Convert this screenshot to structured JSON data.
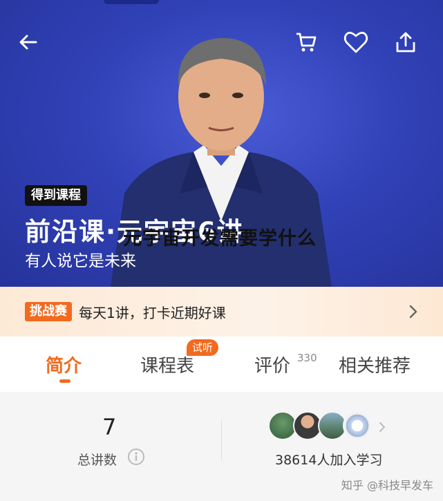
{
  "header": {
    "back_icon": "arrow-left-icon",
    "cart_icon": "cart-icon",
    "favorite_icon": "heart-icon",
    "share_icon": "share-icon"
  },
  "hero": {
    "tag": "得到课程",
    "title": "前沿课·元宇宙6讲",
    "subtitle": "有人说它是未来",
    "overlay_text": "元宇宙开发需要学什么"
  },
  "challenge": {
    "badge": "挑战赛",
    "text": "每天1讲，打卡近期好课",
    "arrow_icon": "chevron-right-icon"
  },
  "tabs": [
    {
      "label": "简介",
      "active": true
    },
    {
      "label": "课程表",
      "badge": "试听"
    },
    {
      "label": "评价",
      "count": "330"
    },
    {
      "label": "相关推荐"
    }
  ],
  "stats": {
    "lecture_count": "7",
    "lecture_label": "总讲数",
    "info_icon": "info-icon",
    "learners_text": "38614人加入学习"
  },
  "watermark": "知乎 @科技早发车",
  "colors": {
    "accent": "#f26a1e",
    "hero_blue": "#3142b8"
  }
}
